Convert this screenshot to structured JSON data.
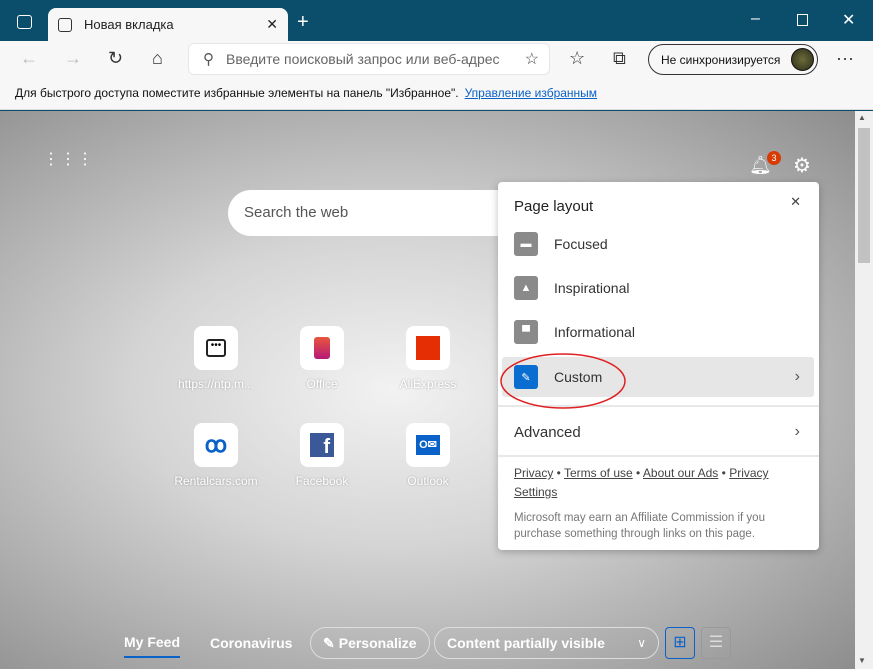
{
  "browser": {
    "tab_title": "Новая вкладка",
    "address_placeholder": "Введите поисковый запрос или веб-адрес",
    "sync_label": "Не синхронизируется"
  },
  "favorites_bar": {
    "message": "Для быстрого доступа поместите избранные элементы на панель \"Избранное\".",
    "link": "Управление избранным"
  },
  "ntp": {
    "search_placeholder": "Search the web",
    "notification_count": "3",
    "tiles": [
      {
        "label": "https://ntp.m...",
        "icon": "page-icon"
      },
      {
        "label": "Office",
        "icon": "office-icon"
      },
      {
        "label": "AliExpress",
        "icon": "aliexpress-icon"
      },
      {
        "label": "Rentalcars.com",
        "icon": "rentalcars-icon"
      },
      {
        "label": "Facebook",
        "icon": "facebook-icon"
      },
      {
        "label": "Outlook",
        "icon": "outlook-icon"
      }
    ]
  },
  "panel": {
    "title": "Page layout",
    "options": [
      {
        "label": "Focused"
      },
      {
        "label": "Inspirational"
      },
      {
        "label": "Informational"
      },
      {
        "label": "Custom",
        "selected": true
      }
    ],
    "advanced": "Advanced",
    "links": [
      "Privacy",
      "Terms of use",
      "About our Ads",
      "Privacy Settings"
    ],
    "disclaimer": "Microsoft may earn an Affiliate Commission if you purchase something through links on this page."
  },
  "feed": {
    "tabs": [
      "My Feed",
      "Coronavirus"
    ],
    "personalize": "Personalize",
    "visibility": "Content partially visible"
  },
  "colors": {
    "titlebar": "#0b4e6b",
    "accent": "#0a62c8",
    "annotation": "#e02020"
  }
}
